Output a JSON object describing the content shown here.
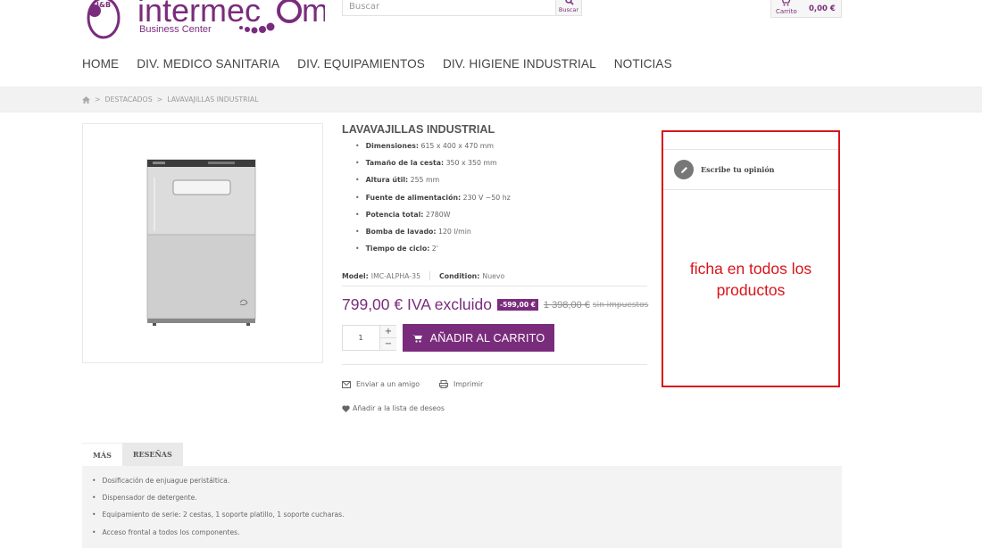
{
  "header": {
    "logo_brand": "Intermecom",
    "logo_tagline": "Business Center",
    "logo_badge": "J&B Group",
    "search_placeholder": "Buscar",
    "search_button_label": "Buscar",
    "cart_label": "Carrito",
    "cart_amount": "0,00 €"
  },
  "nav": {
    "items": [
      "HOME",
      "DIV. MEDICO SANITARIA",
      "DIV. EQUIPAMIENTOS",
      "DIV. HIGIENE INDUSTRIAL",
      "NOTICIAS"
    ]
  },
  "breadcrumb": {
    "sep": ">",
    "items": [
      "DESTACADOS",
      "LAVAVAJILLAS INDUSTRIAL"
    ]
  },
  "product": {
    "title": "LAVAVAJILLAS INDUSTRIAL",
    "specs": [
      {
        "label": "Dimensiones:",
        "value": "615 x 400 x 470 mm"
      },
      {
        "label": "Tamaño de la cesta:",
        "value": "350 x 350 mm"
      },
      {
        "label": "Altura útil:",
        "value": "255 mm"
      },
      {
        "label": "Fuente de alimentación:",
        "value": "230 V ~50 hz"
      },
      {
        "label": "Potencia total:",
        "value": "2780W"
      },
      {
        "label": "Bomba de lavado:",
        "value": "120 l/min"
      },
      {
        "label": "Tiempo de ciclo:",
        "value": "2'"
      }
    ],
    "model_label": "Model:",
    "model_value": "IMC-ALPHA-35",
    "condition_label": "Condition:",
    "condition_value": "Nuevo",
    "price": "799,00 € IVA excluido",
    "discount": "-599,00 €",
    "old_price": "1 398,00 €",
    "old_price_note": "sin impuestos",
    "quantity": "1",
    "qty_plus": "+",
    "qty_minus": "−",
    "add_to_cart": "AÑADIR AL CARRITO",
    "send_friend": "Enviar a un amigo",
    "print": "Imprimir",
    "wishlist": "Añadir a la lista de deseos"
  },
  "opinion": {
    "write_review": "Escribe tu opinión",
    "note": "ficha en todos los productos",
    "highlight_color": "#d9141b"
  },
  "tabs": {
    "items": [
      "MÁS",
      "RESEÑAS"
    ],
    "active": "MÁS",
    "content": [
      "Dosificación de enjuague peristáltica.",
      "Dispensador de detergente.",
      "Equipamiento de serie: 2 cestas, 1 soporte platillo, 1 soporte cucharas.",
      "Acceso frontal a todos los componentes."
    ]
  },
  "colors": {
    "brand": "#7a2c7c",
    "annotation": "#d9141b"
  }
}
